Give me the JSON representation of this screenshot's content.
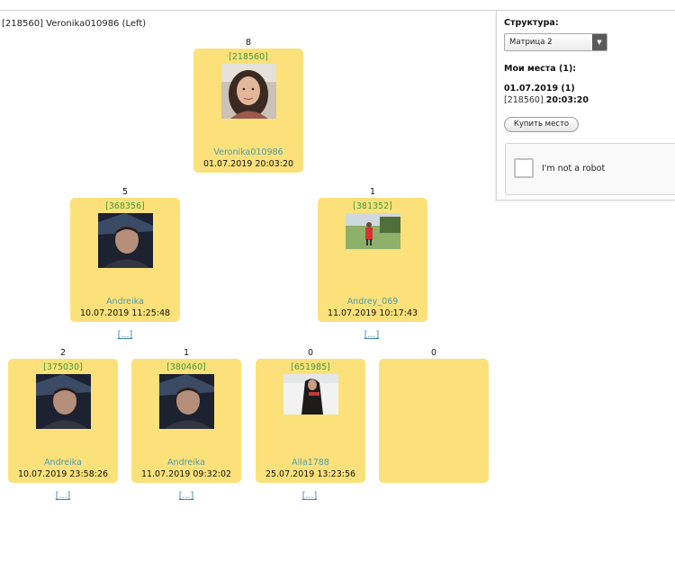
{
  "header": {
    "label": "[218560] Veronika010986 (Left)"
  },
  "tree": {
    "root": {
      "count": "8",
      "id": "[218560]",
      "name": "Veronika010986",
      "date": "01.07.2019 20:03:20"
    },
    "level2": [
      {
        "count": "5",
        "id": "[368356]",
        "name": "Andreika",
        "date": "10.07.2019 11:25:48",
        "more": "[...]"
      },
      {
        "count": "1",
        "id": "[381352]",
        "name": "Andrey_069",
        "date": "11.07.2019 10:17:43",
        "more": "[...]"
      }
    ],
    "level3": [
      {
        "count": "2",
        "id": "[375030]",
        "name": "Andreika",
        "date": "10.07.2019 23:58:26",
        "more": "[...]"
      },
      {
        "count": "1",
        "id": "[380460]",
        "name": "Andreika",
        "date": "11.07.2019 09:32:02",
        "more": "[...]"
      },
      {
        "count": "0",
        "id": "[651985]",
        "name": "Alla1788",
        "date": "25.07.2019 13:23:56",
        "more": "[...]"
      },
      {
        "count": "0"
      }
    ]
  },
  "sidebar": {
    "structure_label": "Структура:",
    "structure_select": "Матрица 2",
    "my_places_label": "Мои места (1):",
    "places_date": "01.07.2019 (1)",
    "places_id": "[218560]",
    "places_time": "20:03:20",
    "buy_button": "Купить место",
    "captcha_text": "I'm not a robot"
  },
  "colors": {
    "card": "#fce17a",
    "id_green": "#3f9a3f",
    "name_teal": "#4a9bb1",
    "link_blue": "#3b7fb0"
  }
}
